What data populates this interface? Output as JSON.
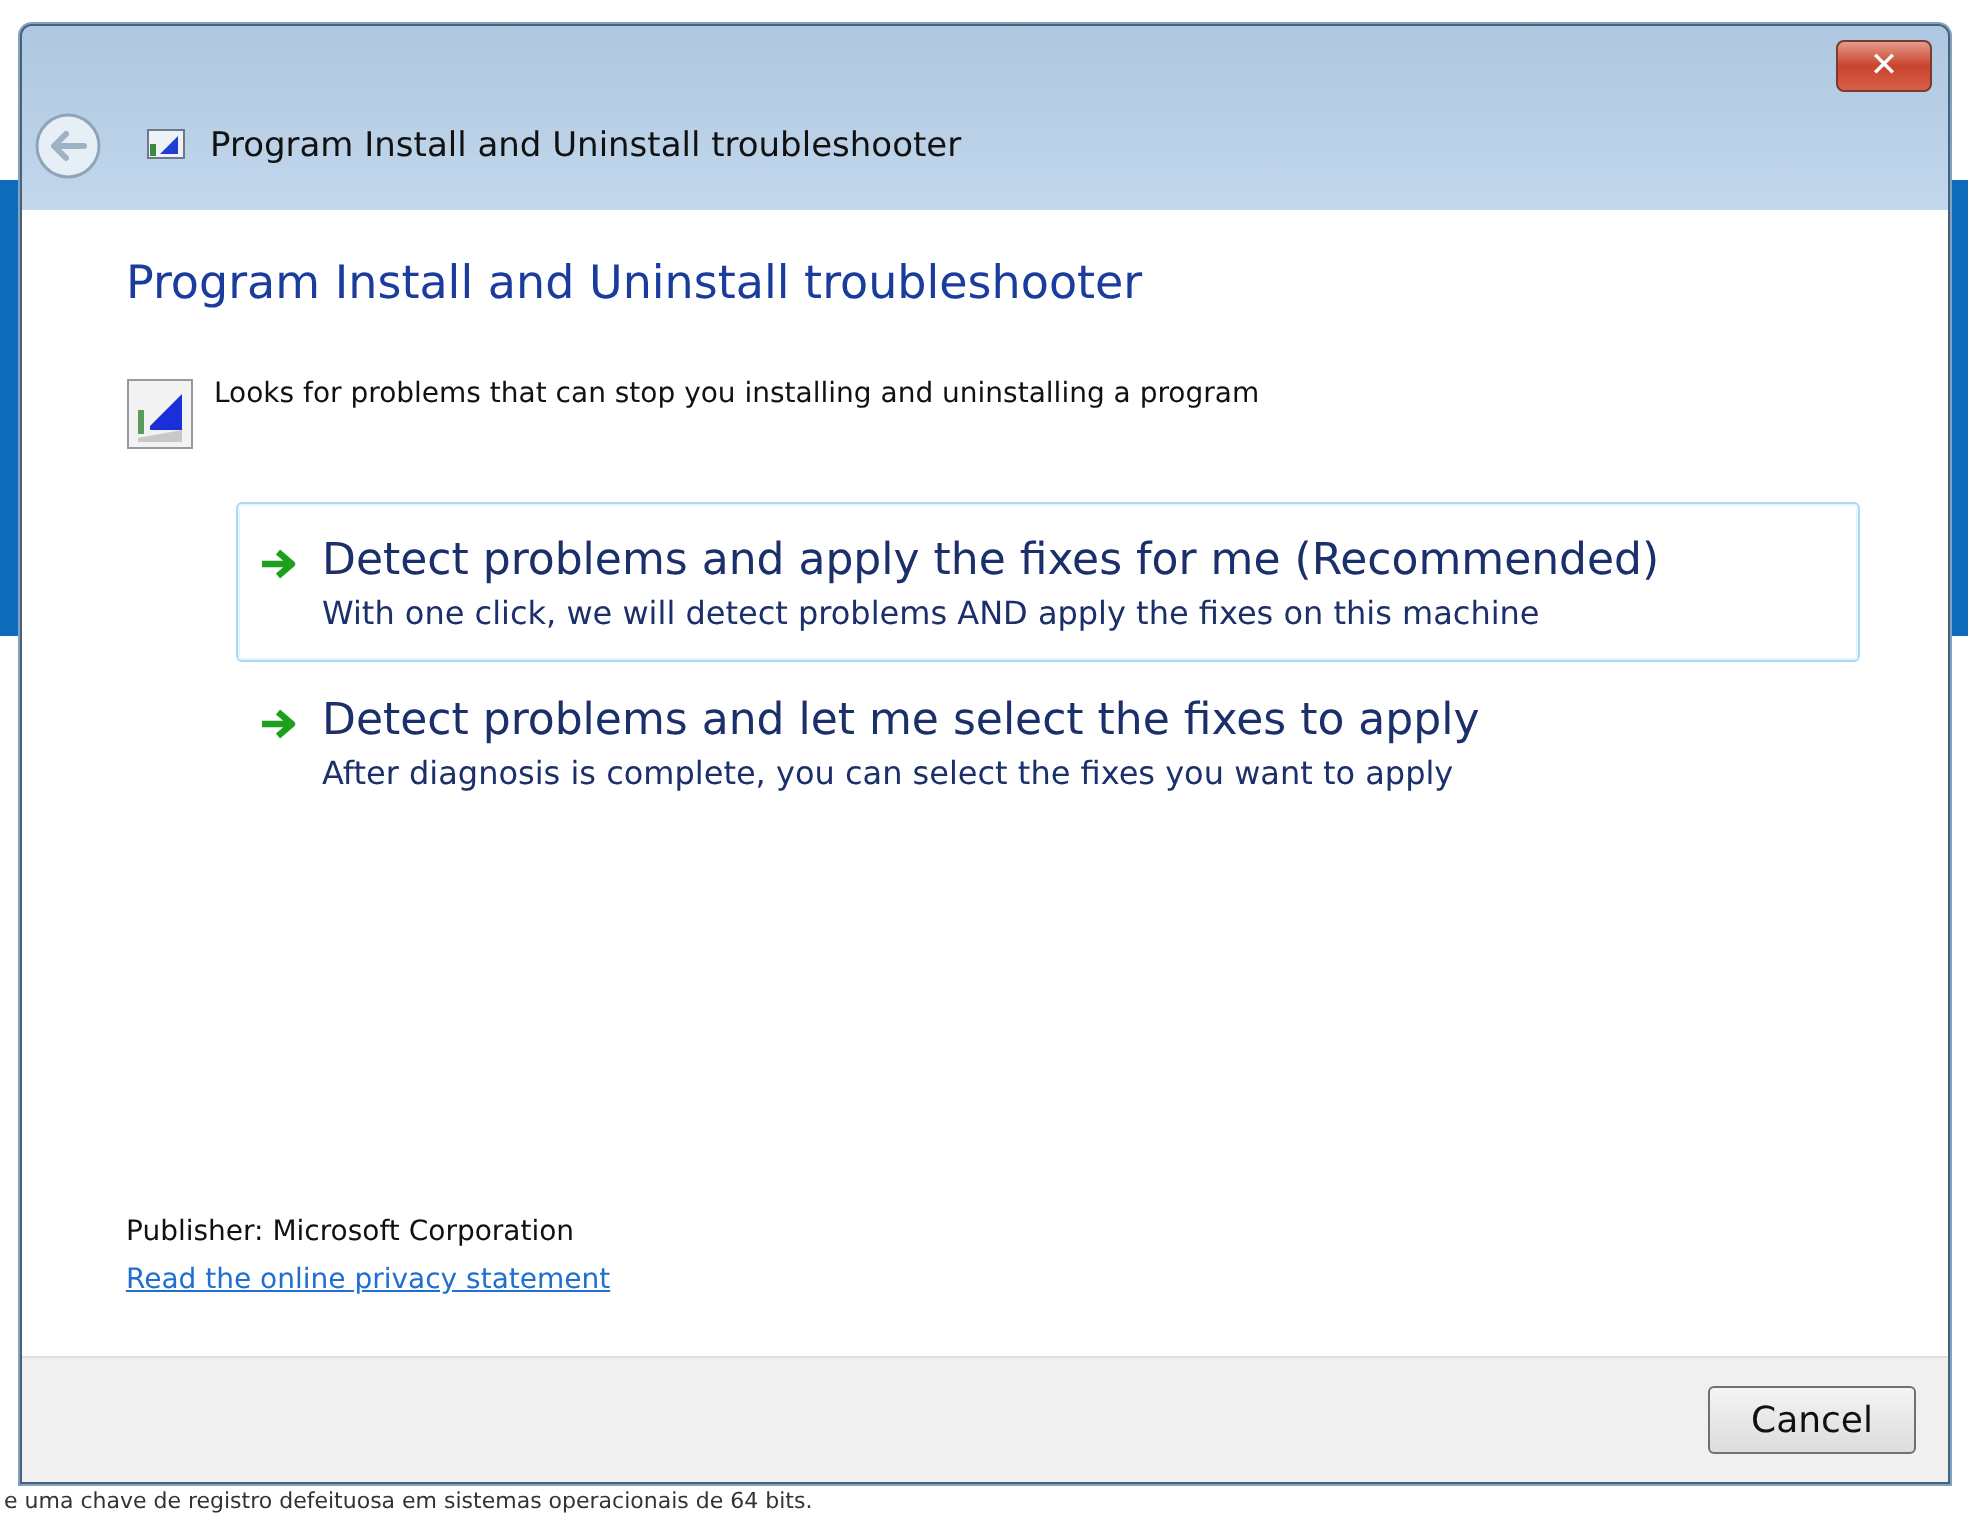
{
  "window": {
    "title": "Program Install and Uninstall troubleshooter",
    "close_button": "✕"
  },
  "heading": "Program Install and Uninstall troubleshooter",
  "description": "Looks for problems that can stop you installing and uninstalling a program",
  "options": [
    {
      "title": "Detect problems and apply the fixes for me (Recommended)",
      "subtitle": "With one click, we will detect problems AND apply the fixes on this machine",
      "selected": true
    },
    {
      "title": "Detect problems and let me select the fixes to apply",
      "subtitle": "After diagnosis is complete, you can select the fixes you want to apply",
      "selected": false
    }
  ],
  "publisher": "Publisher: Microsoft Corporation",
  "privacy_link": "Read the online privacy statement",
  "buttons": [
    "Cancel"
  ],
  "background_caption": "e uma chave de registro defeituosa em sistemas operacionais de 64 bits."
}
